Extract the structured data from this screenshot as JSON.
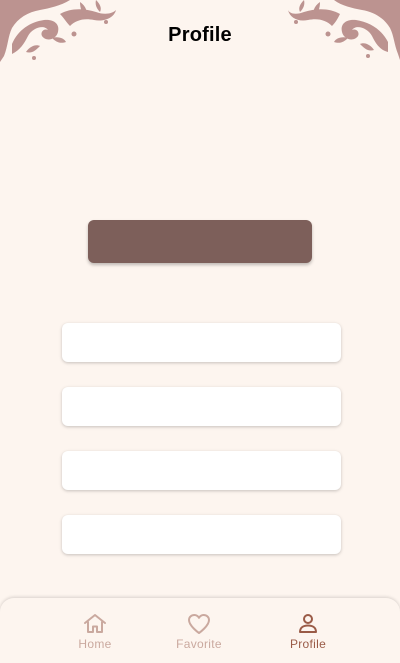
{
  "header": {
    "title": "Profile"
  },
  "colors": {
    "background": "#fdf5ef",
    "ornament": "#b98e8b",
    "primary_button": "#7d5f5a",
    "field": "#ffffff",
    "nav_inactive": "#caa99f",
    "nav_active": "#9a5b47"
  },
  "main": {
    "primary_button_label": "",
    "fields": [
      {
        "value": "",
        "placeholder": ""
      },
      {
        "value": "",
        "placeholder": ""
      },
      {
        "value": "",
        "placeholder": ""
      },
      {
        "value": "",
        "placeholder": ""
      }
    ]
  },
  "bottom_nav": {
    "items": [
      {
        "label": "Home",
        "icon": "home-icon",
        "active": false
      },
      {
        "label": "Favorite",
        "icon": "heart-icon",
        "active": false
      },
      {
        "label": "Profile",
        "icon": "person-icon",
        "active": true
      }
    ]
  }
}
